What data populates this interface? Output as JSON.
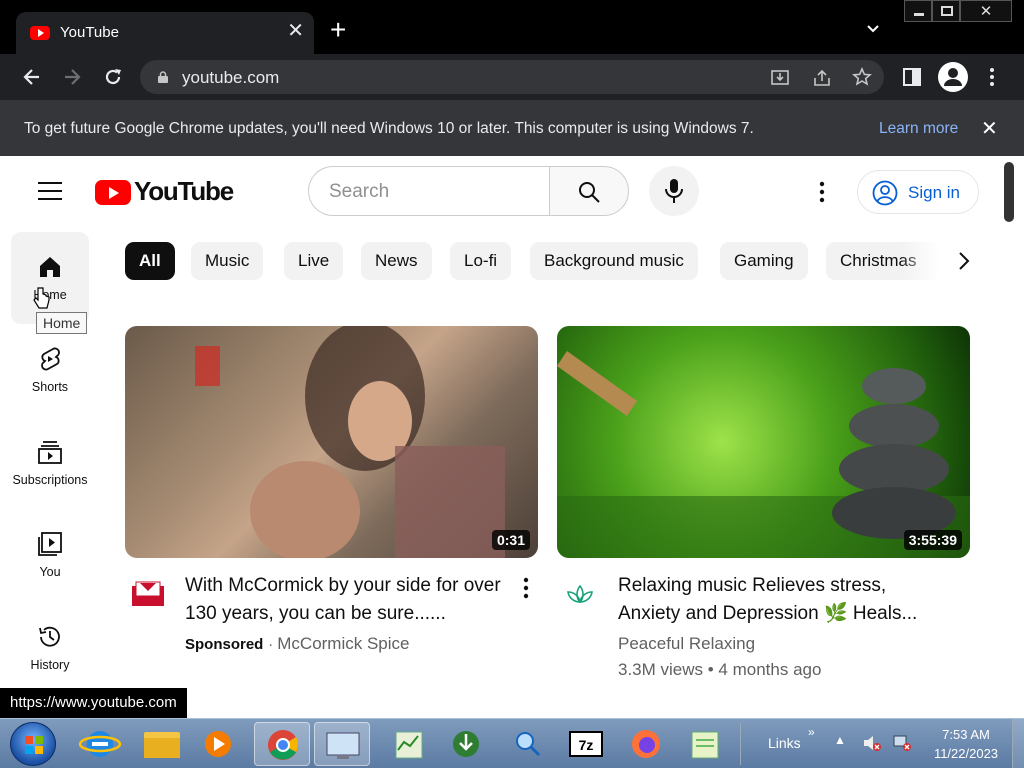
{
  "browser": {
    "tab_title": "YouTube",
    "url": "youtube.com",
    "info_bar_text": "To get future Google Chrome updates, you'll need Windows 10 or later. This computer is using Windows 7.",
    "info_bar_link": "Learn more",
    "status_url": "https://www.youtube.com"
  },
  "header": {
    "logo_text": "YouTube",
    "search_placeholder": "Search",
    "sign_in": "Sign in"
  },
  "guide": {
    "items": [
      {
        "label": "Home",
        "icon": "home-icon"
      },
      {
        "label": "Shorts",
        "icon": "shorts-icon"
      },
      {
        "label": "Subscriptions",
        "icon": "subscriptions-icon"
      },
      {
        "label": "You",
        "icon": "you-icon"
      },
      {
        "label": "History",
        "icon": "history-icon"
      }
    ],
    "tooltip": "Home"
  },
  "chips": [
    "All",
    "Music",
    "Live",
    "News",
    "Lo-fi",
    "Background music",
    "Gaming",
    "Christmas"
  ],
  "videos": [
    {
      "title": "With McCormick by your side for over 130 years, you can be sure......",
      "sponsored": "Sponsored",
      "channel": "McCormick Spice",
      "duration": "0:31"
    },
    {
      "title": "Relaxing music Relieves stress, Anxiety and Depression 🌿 Heals...",
      "channel": "Peaceful Relaxing",
      "stats": "3.3M views • 4 months ago",
      "duration": "3:55:39"
    }
  ],
  "taskbar": {
    "links_label": "Links",
    "time": "7:53 AM",
    "date": "11/22/2023"
  },
  "colors": {
    "yt_red": "#ff0000",
    "link_blue": "#065fd4",
    "chrome_dark": "#202124"
  }
}
